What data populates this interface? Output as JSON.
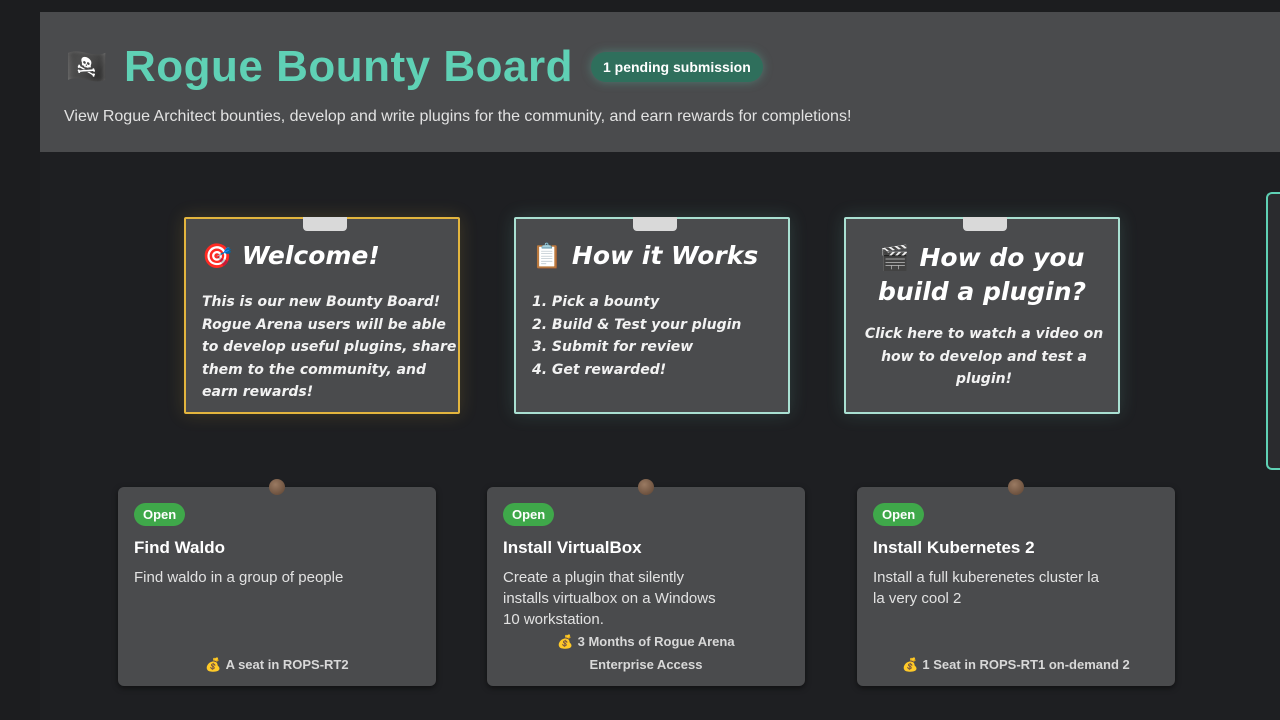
{
  "header": {
    "flag_icon": "🏴‍☠️",
    "title": "Rogue Bounty Board",
    "badge": "1 pending submission",
    "subtitle": "View Rogue Architect bounties, develop and write plugins for the community, and earn rewards for completions!"
  },
  "notes": [
    {
      "icon": "🎯",
      "title": "Welcome!",
      "lines": [
        "This is our new Bounty Board!",
        "Rogue Arena users will be able",
        "to develop useful plugins, share",
        "them to the community, and",
        "earn rewards!"
      ]
    },
    {
      "icon": "📋",
      "title": "How it Works",
      "lines": [
        "1. Pick a bounty",
        "2. Build & Test your plugin",
        "3. Submit for review",
        "4. Get rewarded!"
      ]
    },
    {
      "icon": "🎬",
      "title_line1": "How do you",
      "title_line2": "build a plugin?",
      "lines": [
        "Click here to watch a video on",
        "how to develop and test a",
        "plugin!"
      ]
    }
  ],
  "bounties": [
    {
      "status": "Open",
      "title": "Find Waldo",
      "desc_lines": [
        "Find waldo in a group of people"
      ],
      "reward_lines": [
        "A seat in ROPS-RT2"
      ]
    },
    {
      "status": "Open",
      "title": "Install VirtualBox",
      "desc_lines": [
        "Create a plugin that silently",
        "installs virtualbox on a Windows",
        "10 workstation."
      ],
      "reward_lines": [
        "3 Months of Rogue Arena",
        "Enterprise Access"
      ]
    },
    {
      "status": "Open",
      "title": "Install Kubernetes 2",
      "desc_lines": [
        "Install a full kuberenetes cluster la",
        "la very cool 2"
      ],
      "reward_lines": [
        "1 Seat in ROPS-RT1 on-demand 2"
      ]
    }
  ],
  "reward_icon": "💰",
  "colors": {
    "accent": "#5fd1b5",
    "welcome_border": "#e3b53e",
    "note_border": "#a9e0d2",
    "open_badge": "#3fa84a"
  }
}
